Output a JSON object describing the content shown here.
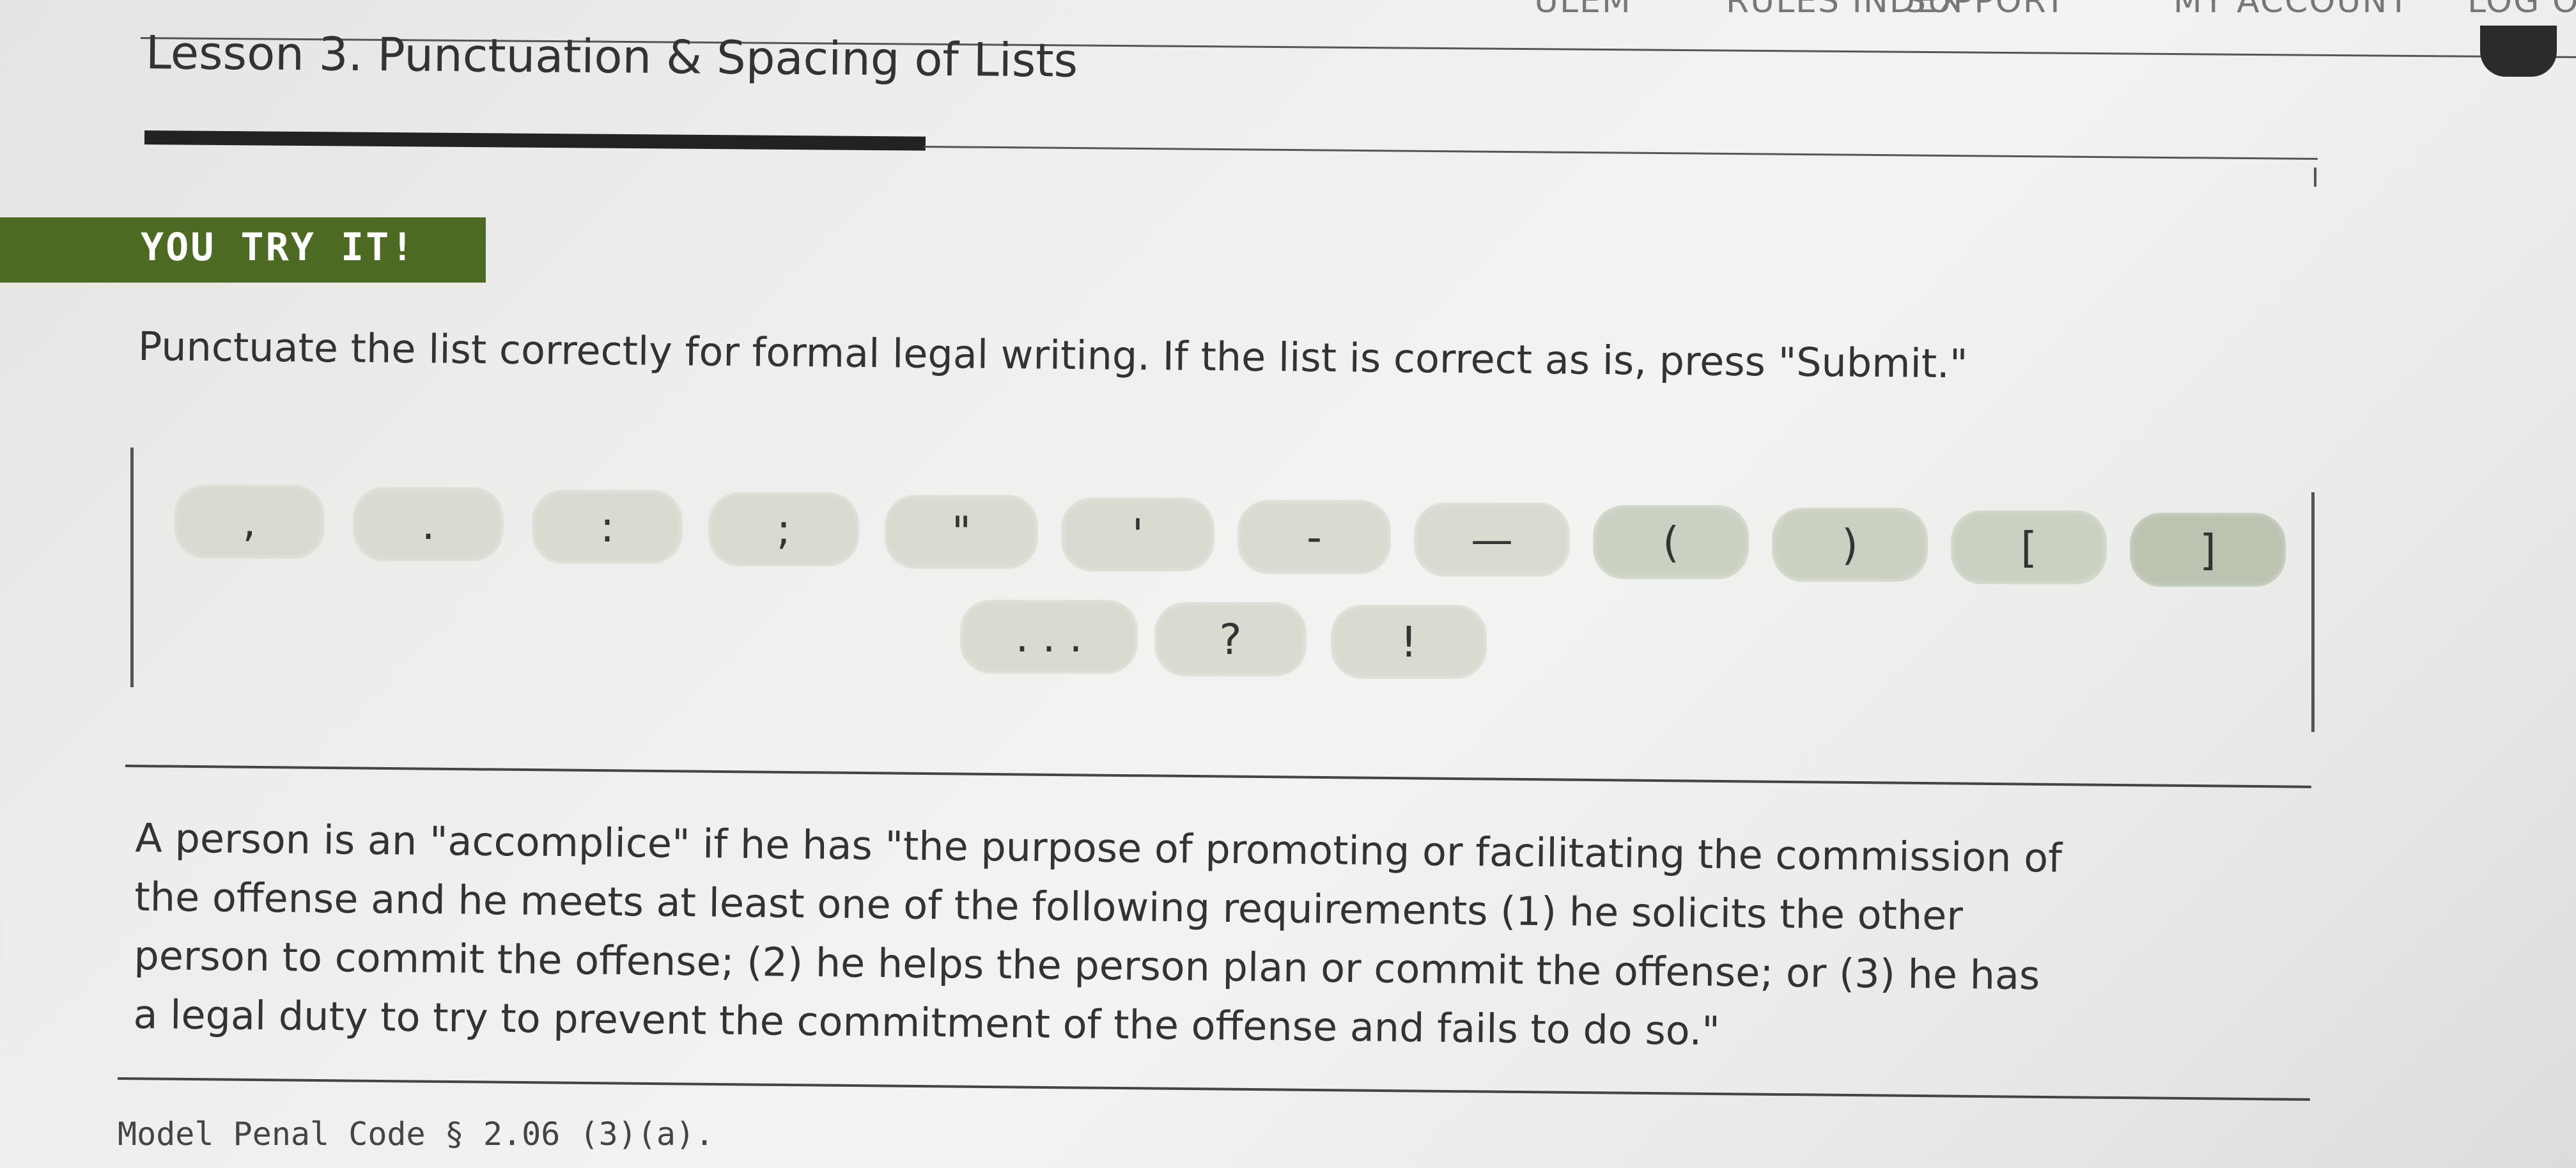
{
  "nav": {
    "items": [
      "RULES INDEX",
      "SUPPORT",
      "MY ACCOUNT",
      "LOG O"
    ],
    "fragment": "ULEM"
  },
  "lesson": {
    "title": "Lesson 3. Punctuation & Spacing of Lists"
  },
  "exercise": {
    "banner": "YOU TRY IT!",
    "instructions": "Punctuate the list correctly for formal legal writing. If the list is correct as is, press \"Submit.\""
  },
  "palette": {
    "buttons": [
      ",",
      ".",
      ":",
      ";",
      "\"",
      "'",
      "-",
      "—",
      "(",
      ")",
      "[",
      "]",
      ". . .",
      "?",
      "!"
    ]
  },
  "passage": {
    "lines": [
      "A person is an \"accomplice\" if he has \"the purpose of promoting or facilitating the commission of",
      "the offense and he meets at least one of the following requirements (1) he solicits the other",
      "person to commit the offense; (2) he helps the person plan or commit the offense; or (3) he has",
      "a legal duty to try to prevent the commitment of the offense and fails to do so.\""
    ]
  },
  "citation": "Model Penal Code § 2.06 (3)(a).",
  "colors": {
    "banner": "#4c6a22",
    "button": "#cbd1c2",
    "background": "#ececea"
  }
}
